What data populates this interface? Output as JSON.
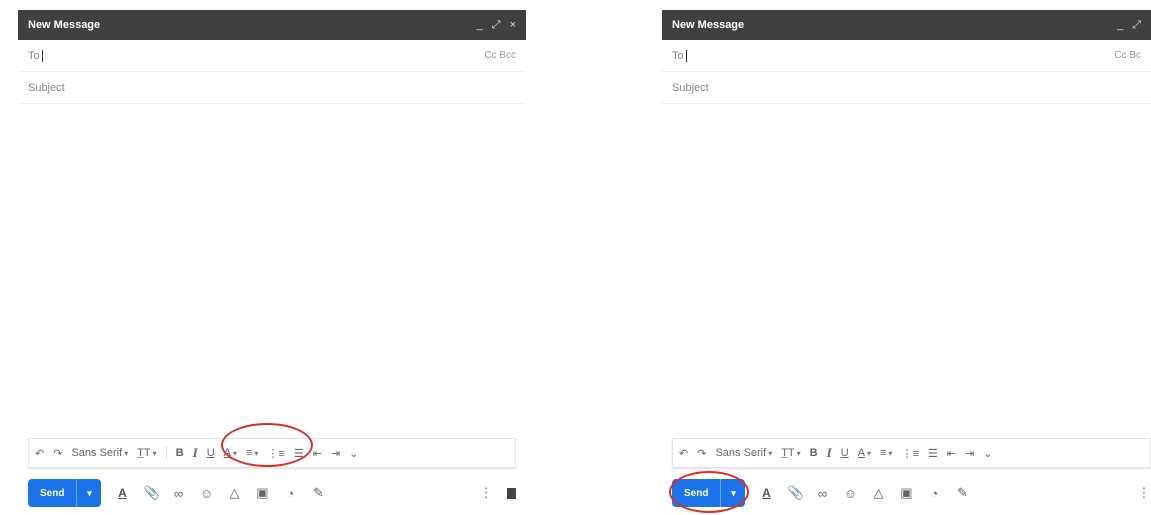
{
  "panels": [
    {
      "compose": {
        "title": "New Message",
        "window_controls": [
          "_",
          "⤢",
          "×"
        ],
        "to_label": "To",
        "cc_bcc_label": "Cc Bcc",
        "subject_placeholder": "Subject"
      },
      "format_toolbar": {
        "undo": "↶",
        "redo": "↷",
        "font": "Sans Serif",
        "font_size": "T̲T",
        "bold": "B",
        "italic": "I",
        "underline": "U",
        "text_color": "A",
        "align": "≡",
        "numbered_list": "⋮≡",
        "bulleted_list": "☰",
        "indent_less": "⇤",
        "indent_more": "⇥",
        "more": "⌄"
      },
      "bottom_bar": {
        "send_label": "Send",
        "more_send_options": "▾",
        "formatting_toggle": "A",
        "attach": "📎",
        "link": "∞",
        "emoji": "☺",
        "drive": "△",
        "photo": "▣",
        "confidential": "◔",
        "signature": "✎",
        "more_options": "⋮"
      },
      "highlight_target": "bold-italic-underline"
    },
    {
      "compose": {
        "title": "New Message",
        "window_controls": [
          "_",
          "⤢"
        ],
        "to_label": "To",
        "cc_bcc_label": "Cc Bc",
        "subject_placeholder": "Subject"
      },
      "format_toolbar": {
        "undo": "↶",
        "redo": "↷",
        "font": "Sans Serif",
        "font_size": "T̲T",
        "bold": "B",
        "italic": "I",
        "underline": "U",
        "text_color": "A",
        "align": "≡",
        "numbered_list": "⋮≡",
        "bulleted_list": "☰",
        "indent_less": "⇤",
        "indent_more": "⇥",
        "more": "⌄"
      },
      "bottom_bar": {
        "send_label": "Send",
        "more_send_options": "▾",
        "formatting_toggle": "A",
        "attach": "📎",
        "link": "∞",
        "emoji": "☺",
        "drive": "△",
        "photo": "▣",
        "confidential": "◔",
        "signature": "✎",
        "more_options": "⋮"
      },
      "highlight_target": "send-button"
    }
  ],
  "colors": {
    "titlebar": "#404040",
    "send_button": "#1a73e8",
    "highlight_circle": "#d93025"
  }
}
